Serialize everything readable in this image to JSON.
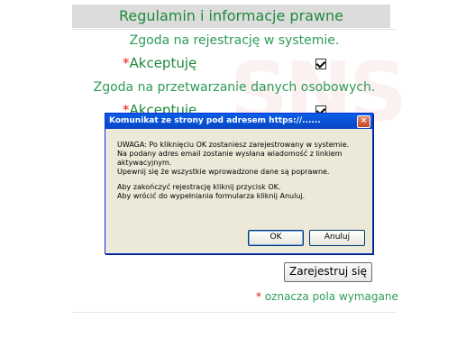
{
  "form": {
    "title": "Regulamin i informacje prawne",
    "consent_registration": "Zgoda na rejestrację w systemie.",
    "accept_label": "Akceptuję",
    "required_star": "*",
    "consent_data": "Zgoda na przetwarzanie danych osobowych.",
    "register_button": "Zarejestruj się",
    "required_note": "oznacza pola wymagane"
  },
  "dialog": {
    "title": "Komunikat ze strony pod adresem https://......",
    "close": "×",
    "line1": "UWAGA: Po kliknięciu OK zostaniesz zarejestrowany w systemie.",
    "line2": "Na podany adres email zostanie wysłana wiadomość z linkiem aktywacyjnym.",
    "line3": "Upewnij się że wszystkie wprowadzone dane są poprawne.",
    "line4": "Aby zakończyć rejestrację kliknij przycisk OK.",
    "line5": "Aby wrócić do wypełniania formularza kliknij Anuluj.",
    "ok_label": "OK",
    "cancel_label": "Anuluj"
  },
  "colors": {
    "accent_green": "#2e9b57",
    "required_red": "#e21b1b",
    "dialog_title_blue": "#0a5ee7"
  }
}
